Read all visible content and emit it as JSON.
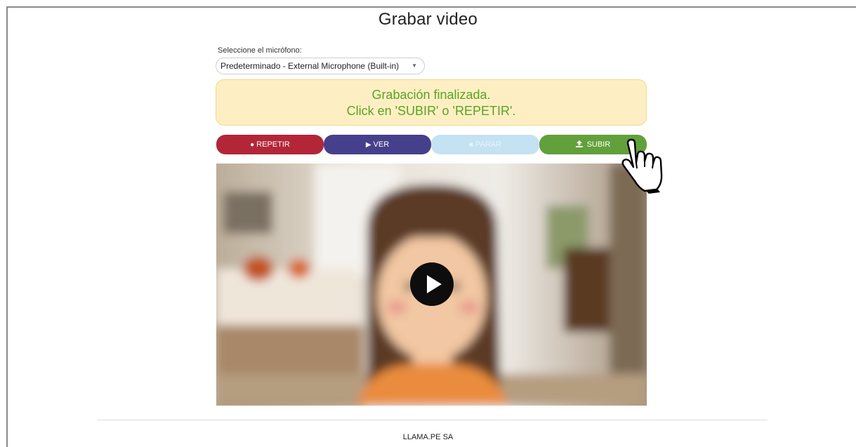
{
  "page": {
    "title": "Grabar video"
  },
  "microphone": {
    "label": "Seleccione el micrófono:",
    "selected": "Predeterminado - External Microphone (Built-in)"
  },
  "status": {
    "line1": "Grabación finalizada.",
    "line2": "Click en 'SUBIR' o 'REPETIR'.",
    "text_color": "#5aa423",
    "background": "#fdefc3"
  },
  "buttons": {
    "repetir": {
      "label": "REPETIR",
      "icon": "circle-icon",
      "color": "#b32638"
    },
    "ver": {
      "label": "VER",
      "icon": "play-icon",
      "color": "#463f8c"
    },
    "parar": {
      "label": "PARAR",
      "icon": "stop-icon",
      "color": "#c4e2f2",
      "state": "disabled"
    },
    "subir": {
      "label": "SUBIR",
      "icon": "upload-icon",
      "color": "#62a03b"
    }
  },
  "video": {
    "play_icon": "play-icon"
  },
  "footer": {
    "text": "LLAMA.PE SA"
  },
  "cursor": {
    "icon": "hand-pointer-icon"
  }
}
